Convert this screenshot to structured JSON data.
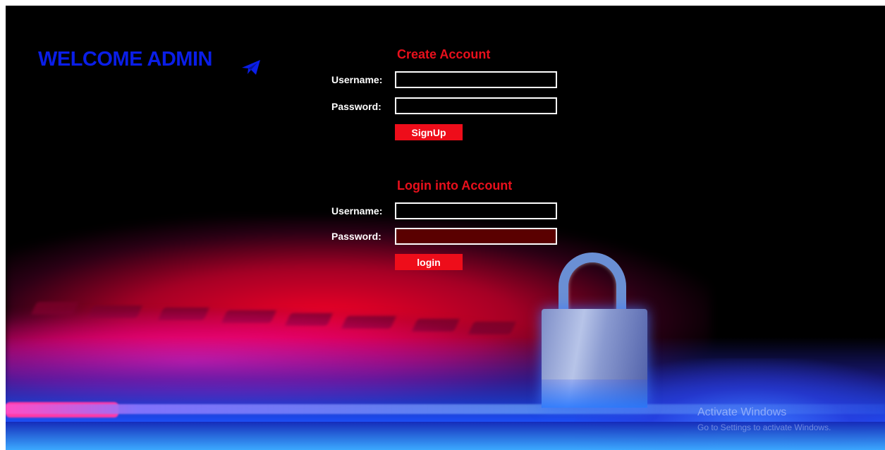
{
  "header": {
    "title": "WELCOME ADMIN",
    "icon": "paper-plane-icon"
  },
  "create_account": {
    "title": "Create Account",
    "username_label": "Username:",
    "username_value": "",
    "password_label": "Password:",
    "password_value": "",
    "submit_label": "SignUp"
  },
  "login_account": {
    "title": "Login into Account",
    "username_label": "Username:",
    "username_value": "",
    "password_label": "Password:",
    "password_value": "",
    "submit_label": "login"
  },
  "watermark": {
    "title": "Activate Windows",
    "subtitle": "Go to Settings to activate Windows."
  },
  "colors": {
    "title_blue": "#0a1ee8",
    "accent_red": "#ee0d1a",
    "background": "#000000"
  }
}
